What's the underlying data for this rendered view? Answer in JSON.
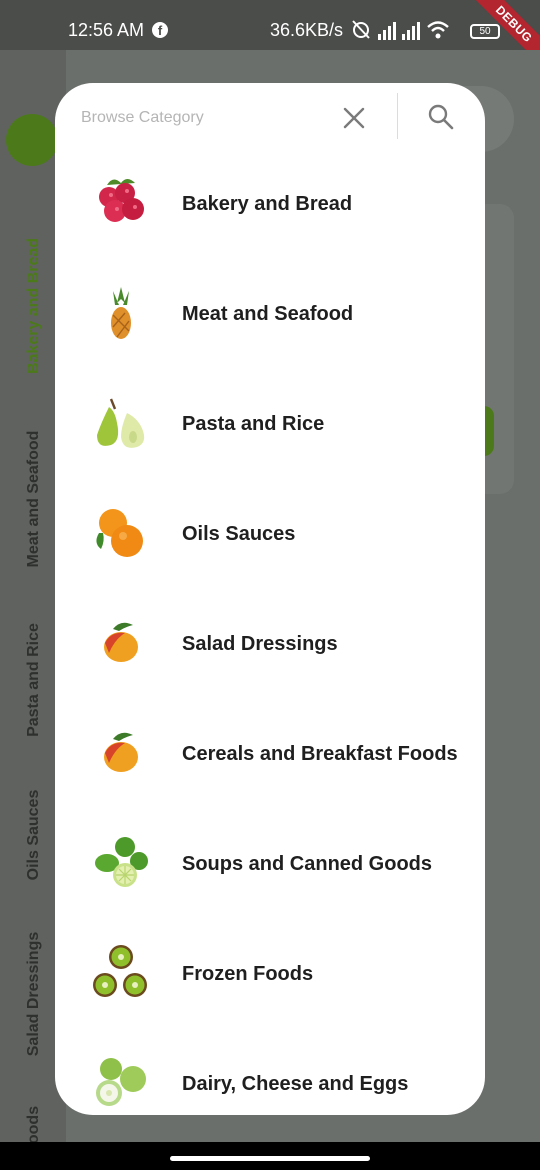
{
  "status_bar": {
    "time": "12:56 AM",
    "network_speed": "36.6KB/s",
    "battery": "50",
    "debug_banner": "DEBUG"
  },
  "background": {
    "rail_labels": [
      "Bakery and Bread",
      "Meat and Seafood",
      "Pasta and Rice",
      "Oils Sauces",
      "Salad Dressings",
      "oods"
    ],
    "accent_color": "#4c7a1a"
  },
  "modal": {
    "search_placeholder": "Browse Category",
    "close_icon": "close-icon",
    "search_icon": "search-icon",
    "categories": [
      {
        "label": "Bakery and Bread",
        "icon": "raspberries-icon"
      },
      {
        "label": "Meat and Seafood",
        "icon": "pineapple-icon"
      },
      {
        "label": "Pasta and Rice",
        "icon": "pear-icon"
      },
      {
        "label": "Oils Sauces",
        "icon": "orange-icon"
      },
      {
        "label": "Salad Dressings",
        "icon": "mango-icon"
      },
      {
        "label": "Cereals and Breakfast Foods",
        "icon": "mango-icon"
      },
      {
        "label": "Soups and Canned Goods",
        "icon": "limes-icon"
      },
      {
        "label": "Frozen Foods",
        "icon": "kiwi-icon"
      },
      {
        "label": "Dairy, Cheese and Eggs",
        "icon": "guava-icon"
      }
    ]
  }
}
